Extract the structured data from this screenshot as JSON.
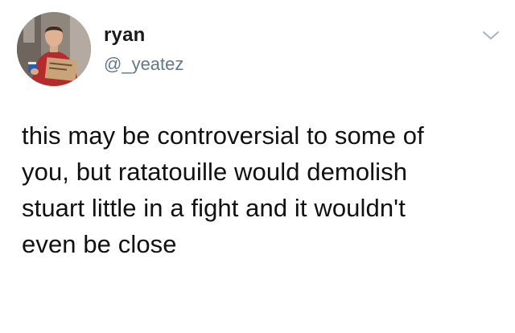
{
  "user": {
    "name": "ryan",
    "handle": "@_yeatez",
    "avatar_icon": "profile-photo"
  },
  "tweet": {
    "text_lines": [
      "this may be controversial to some of",
      "you, but ratatouille would demolish",
      "stuart little in a fight and it wouldn't",
      "even be close"
    ]
  },
  "icons": {
    "menu": "chevron-down-icon"
  },
  "colors": {
    "text": "#111111",
    "secondary": "#657786",
    "background": "#ffffff"
  }
}
